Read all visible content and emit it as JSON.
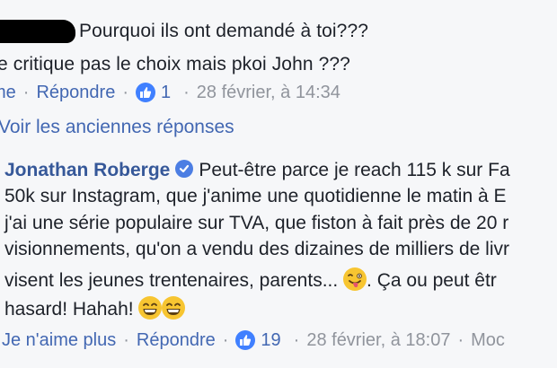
{
  "comment1": {
    "line1": "Pourquoi ils ont demandé à toi???",
    "line2": "e critique pas le choix mais pkoi John ???",
    "actions": {
      "like": "me",
      "reply": "Répondre",
      "like_count": "1",
      "timestamp": "28 février, à 14:34"
    }
  },
  "older_replies": "Voir les anciennes réponses",
  "comment2": {
    "author": "Jonathan Roberge",
    "line1": "Peut-être parce je reach 115 k sur Fa",
    "line2": "50k sur Instagram, que j'anime une quotidienne le matin à E",
    "line3": "j'ai une série populaire sur TVA, que fiston à fait près de 20 r",
    "line4": "visionnements, qu'on a vendu des dizaines de milliers de livr",
    "line5a": "visent les jeunes trentenaires, parents...",
    "line5b": ". Ça ou peut êtr",
    "line6": "hasard! Hahah!",
    "actions": {
      "unlike": "Je n'aime plus",
      "reply": "Répondre",
      "like_count": "19",
      "timestamp": "28 février, à 18:07",
      "more": "Moc"
    }
  },
  "icons": {
    "like": "thumbs-up-icon",
    "verified": "verified-badge-icon",
    "winking_tongue": "winking-tongue-emoji",
    "grinning": "grinning-emoji"
  },
  "colors": {
    "background": "#f6f7f9",
    "text": "#1d2129",
    "link": "#4267b2",
    "author": "#365899",
    "meta": "#90949c",
    "like_badge": "#4080ff"
  }
}
